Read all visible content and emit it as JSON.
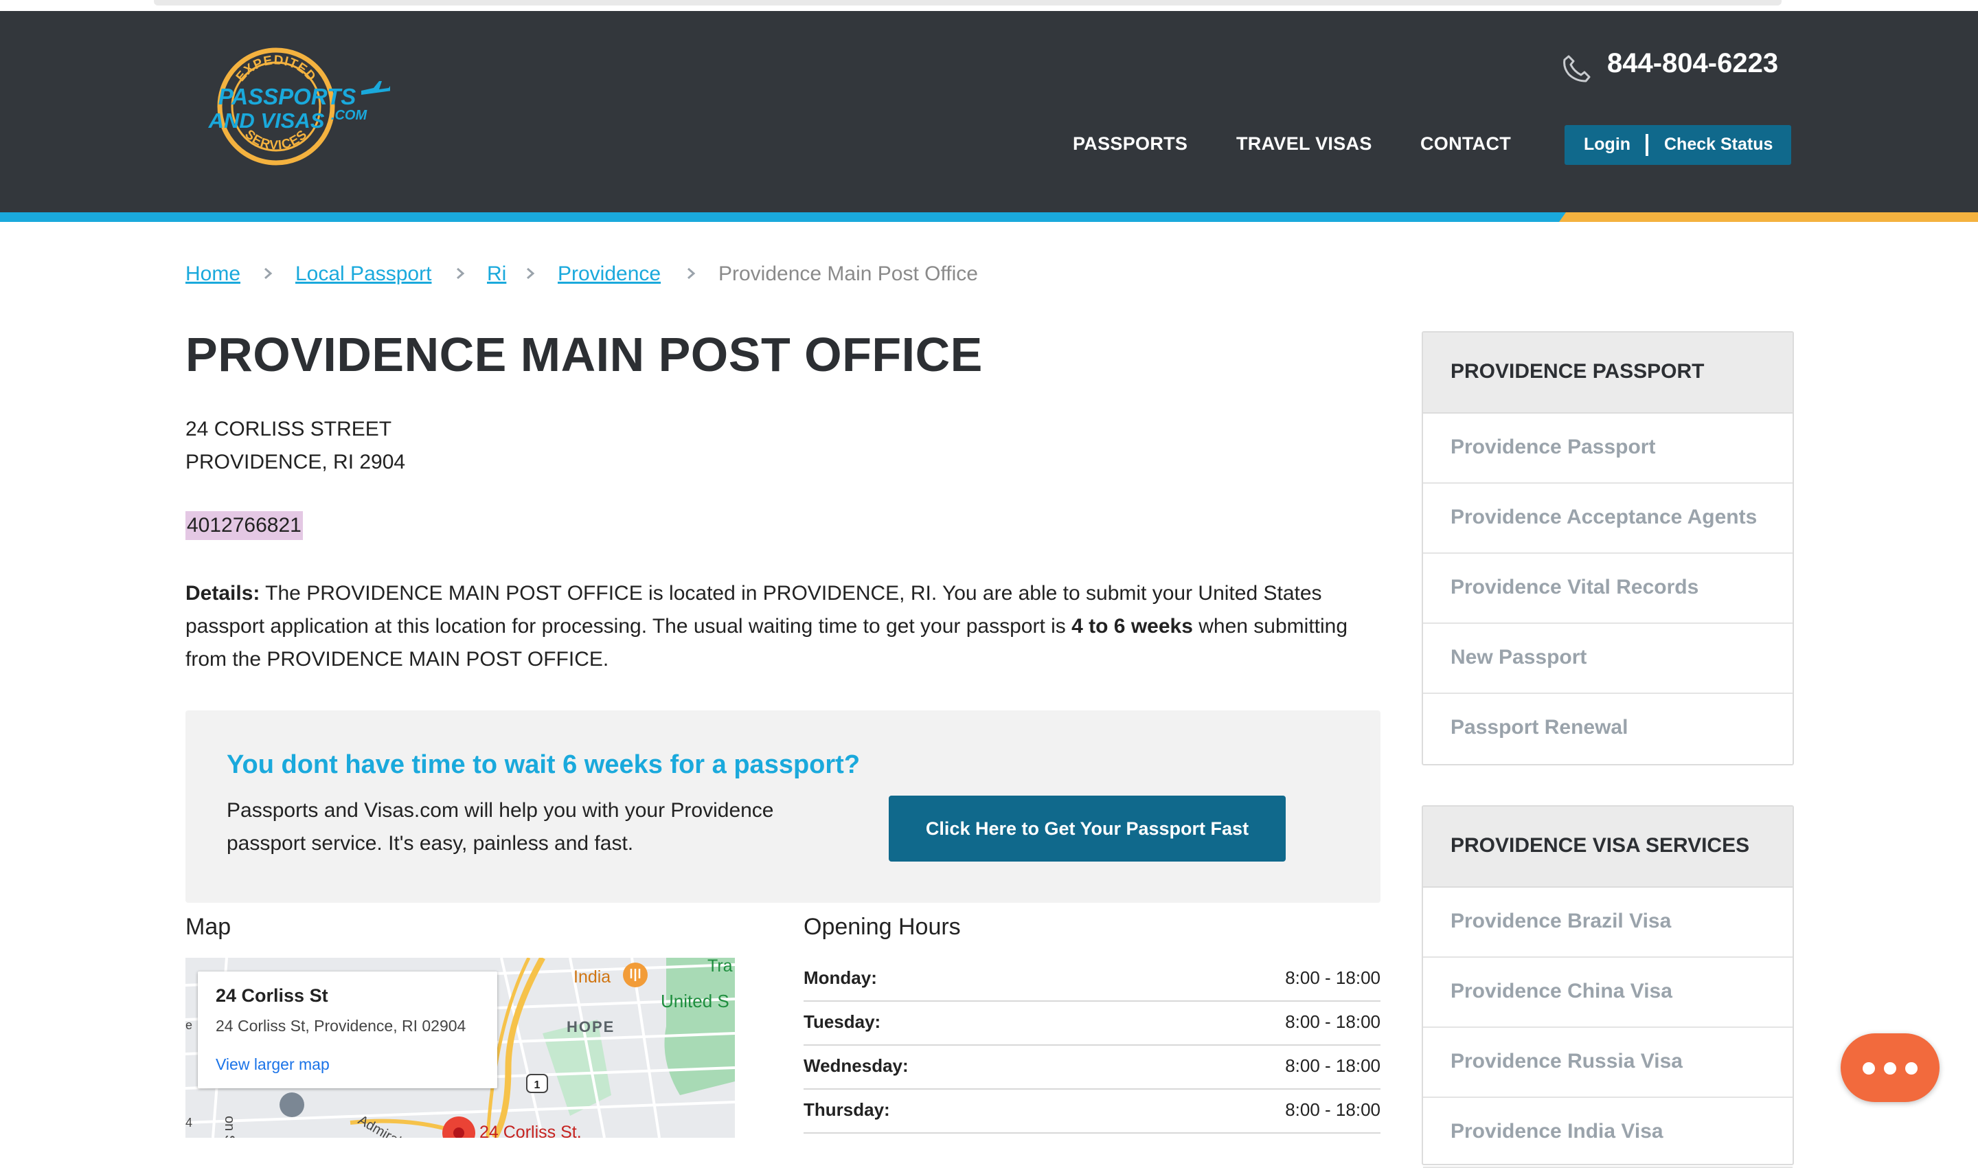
{
  "header": {
    "phone": "844-804-6223",
    "logo": {
      "line_top": "EXPEDITED",
      "line_main1": "PASSPORTS",
      "line_main2": "AND VISAS",
      "line_com": ".COM",
      "line_bottom": "SERVICES"
    },
    "nav": [
      {
        "label": "PASSPORTS"
      },
      {
        "label": "TRAVEL VISAS"
      },
      {
        "label": "CONTACT"
      }
    ],
    "login_label": "Login",
    "check_status_label": "Check Status"
  },
  "breadcrumb": [
    {
      "label": "Home"
    },
    {
      "label": "Local Passport"
    },
    {
      "label": "Ri"
    },
    {
      "label": "Providence"
    },
    {
      "label": "Providence Main Post Office"
    }
  ],
  "main": {
    "title": "PROVIDENCE MAIN POST OFFICE",
    "address_line1": "24 CORLISS STREET",
    "address_line2": "PROVIDENCE, RI 2904",
    "phone": "4012766821",
    "details_label": "Details:",
    "details_p1": " The PROVIDENCE MAIN POST OFFICE is located in PROVIDENCE, RI. You are able to submit your United States passport application at this location for processing. The usual waiting time to get your passport is ",
    "details_bold": "4 to 6 weeks",
    "details_p2": " when submitting from the PROVIDENCE MAIN POST OFFICE."
  },
  "promo": {
    "heading": "You dont have time to wait 6 weeks for a passport?",
    "text": "Passports and Visas.com will help you with your Providence passport service. It's easy, painless and fast.",
    "button": "Click Here to Get Your Passport Fast"
  },
  "map": {
    "label": "Map",
    "card_title": "24 Corliss St",
    "card_address": "24 Corliss St, Providence, RI 02904",
    "card_link": "View larger map",
    "labels": {
      "india": "India",
      "hope": "HOPE",
      "united": "United S",
      "tra": "Tra",
      "admiral": "Admiral",
      "on_st": "on St",
      "pin_label": "24 Corliss St.",
      "route": "1",
      "e": "e",
      "four": "4"
    }
  },
  "hours": {
    "label": "Opening Hours",
    "rows": [
      {
        "day": "Monday:",
        "time": "8:00 - 18:00"
      },
      {
        "day": "Tuesday:",
        "time": "8:00 - 18:00"
      },
      {
        "day": "Wednesday:",
        "time": "8:00 - 18:00"
      },
      {
        "day": "Thursday:",
        "time": "8:00 - 18:00"
      }
    ]
  },
  "sidebar": {
    "passport": {
      "heading": "PROVIDENCE PASSPORT",
      "items": [
        "Providence Passport",
        "Providence Acceptance Agents",
        "Providence Vital Records",
        "New Passport",
        "Passport Renewal"
      ]
    },
    "visa": {
      "heading": "PROVIDENCE VISA SERVICES",
      "items": [
        "Providence Brazil Visa",
        "Providence China Visa",
        "Providence Russia Visa",
        "Providence India Visa"
      ]
    }
  },
  "colors": {
    "header_bg": "#33373c",
    "accent_blue": "#1aa9dc",
    "accent_orange": "#f4b23f",
    "button_blue": "#10698c",
    "chat_orange": "#f26a3d"
  }
}
